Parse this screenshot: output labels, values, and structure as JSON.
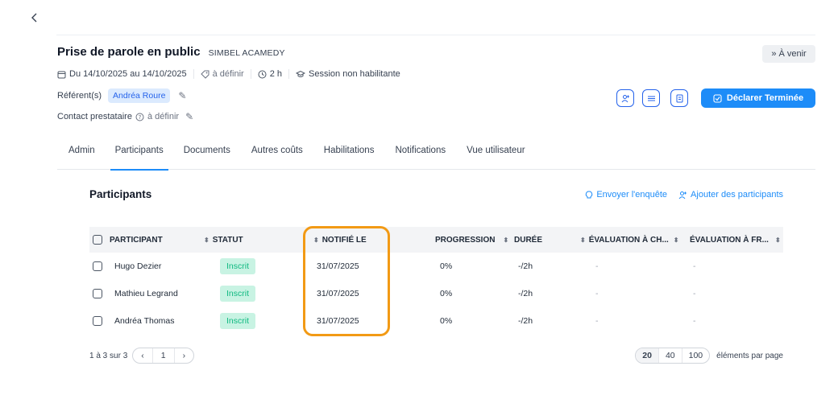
{
  "header": {
    "title": "Prise de parole en public",
    "provider": "SIMBEL ACAMEDY",
    "status": "À venir"
  },
  "meta": {
    "dates": "Du 14/10/2025 au 14/10/2025",
    "location": "à définir",
    "duration": "2 h",
    "session_type": "Session non habilitante"
  },
  "referents": {
    "label": "Référent(s)",
    "name": "Andréa Roure"
  },
  "contact": {
    "label": "Contact prestataire",
    "value": "à définir"
  },
  "actions": {
    "declare_label": "Déclarer Terminée"
  },
  "tabs": [
    {
      "label": "Admin"
    },
    {
      "label": "Participants"
    },
    {
      "label": "Documents"
    },
    {
      "label": "Autres coûts"
    },
    {
      "label": "Habilitations"
    },
    {
      "label": "Notifications"
    },
    {
      "label": "Vue utilisateur"
    }
  ],
  "section": {
    "title": "Participants",
    "send_survey": "Envoyer l'enquête",
    "add_participants": "Ajouter des participants"
  },
  "table": {
    "columns": [
      "PARTICIPANT",
      "STATUT",
      "NOTIFIÉ LE",
      "PROGRESSION",
      "DURÉE",
      "ÉVALUATION À CH...",
      "ÉVALUATION À FR..."
    ],
    "rows": [
      {
        "name": "Hugo Dezier",
        "status": "Inscrit",
        "notified": "31/07/2025",
        "progress": "0%",
        "duration": "-/2h",
        "eval_ch": "-",
        "eval_fr": "-"
      },
      {
        "name": "Mathieu Legrand",
        "status": "Inscrit",
        "notified": "31/07/2025",
        "progress": "0%",
        "duration": "-/2h",
        "eval_ch": "-",
        "eval_fr": "-"
      },
      {
        "name": "Andréa Thomas",
        "status": "Inscrit",
        "notified": "31/07/2025",
        "progress": "0%",
        "duration": "-/2h",
        "eval_ch": "-",
        "eval_fr": "-"
      }
    ]
  },
  "pagination": {
    "summary": "1 à 3 sur 3",
    "current_page": "1",
    "page_sizes": [
      "20",
      "40",
      "100"
    ],
    "page_size_label": "éléments par page"
  },
  "colors": {
    "primary": "#1d8cf8",
    "highlight": "#f29a15",
    "status_badge_bg": "#c8f3e3",
    "status_badge_text": "#10b981"
  }
}
